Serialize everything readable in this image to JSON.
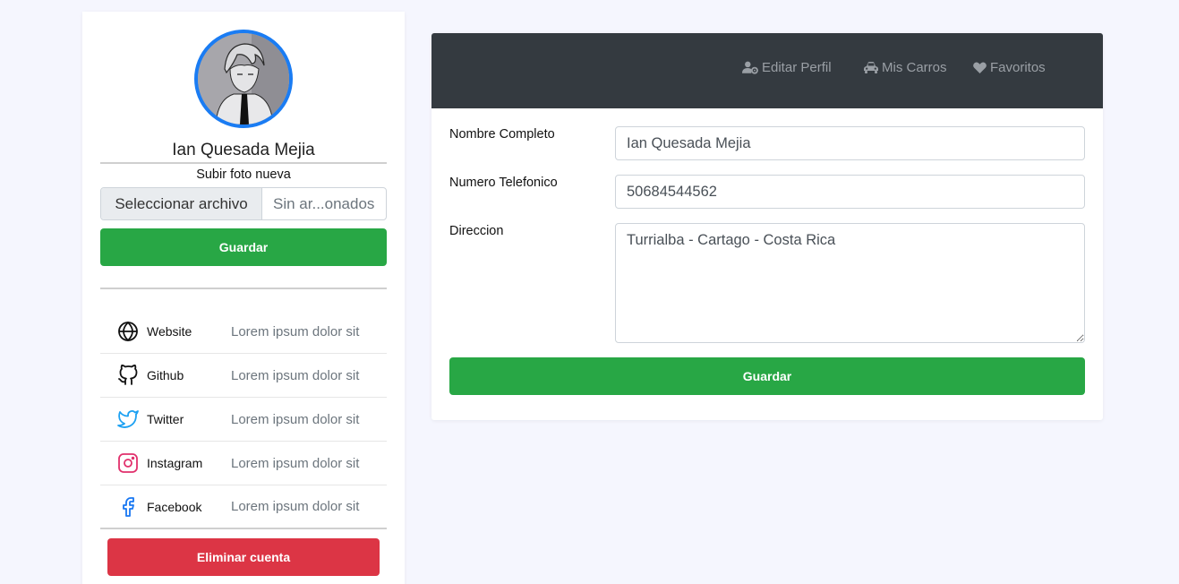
{
  "profile": {
    "name": "Ian Quesada Mejia",
    "upload_label": "Subir foto nueva",
    "file_button": "Seleccionar archivo",
    "file_status": "Sin ar...onados",
    "save_label": "Guardar",
    "delete_label": "Eliminar cuenta"
  },
  "social": [
    {
      "icon": "globe-icon",
      "name": "Website",
      "value": "Lorem ipsum dolor sit"
    },
    {
      "icon": "github-icon",
      "name": "Github",
      "value": "Lorem ipsum dolor sit"
    },
    {
      "icon": "twitter-icon",
      "name": "Twitter",
      "value": "Lorem ipsum dolor sit"
    },
    {
      "icon": "instagram-icon",
      "name": "Instagram",
      "value": "Lorem ipsum dolor sit"
    },
    {
      "icon": "facebook-icon",
      "name": "Facebook",
      "value": "Lorem ipsum dolor sit"
    }
  ],
  "nav": {
    "edit_profile": "Editar Perfil",
    "my_cars": "Mis Carros",
    "favorites": "Favoritos"
  },
  "form": {
    "name_label": "Nombre Completo",
    "name_value": "Ian Quesada Mejia",
    "phone_label": "Numero Telefonico",
    "phone_value": "50684544562",
    "address_label": "Direccion",
    "address_value": "Turrialba - Cartago - Costa Rica",
    "save_label": "Guardar"
  },
  "colors": {
    "accent_blue": "#1a7cf3",
    "success": "#28a745",
    "danger": "#dc3545",
    "navbar": "#343a40",
    "background": "#f5f6fe"
  }
}
